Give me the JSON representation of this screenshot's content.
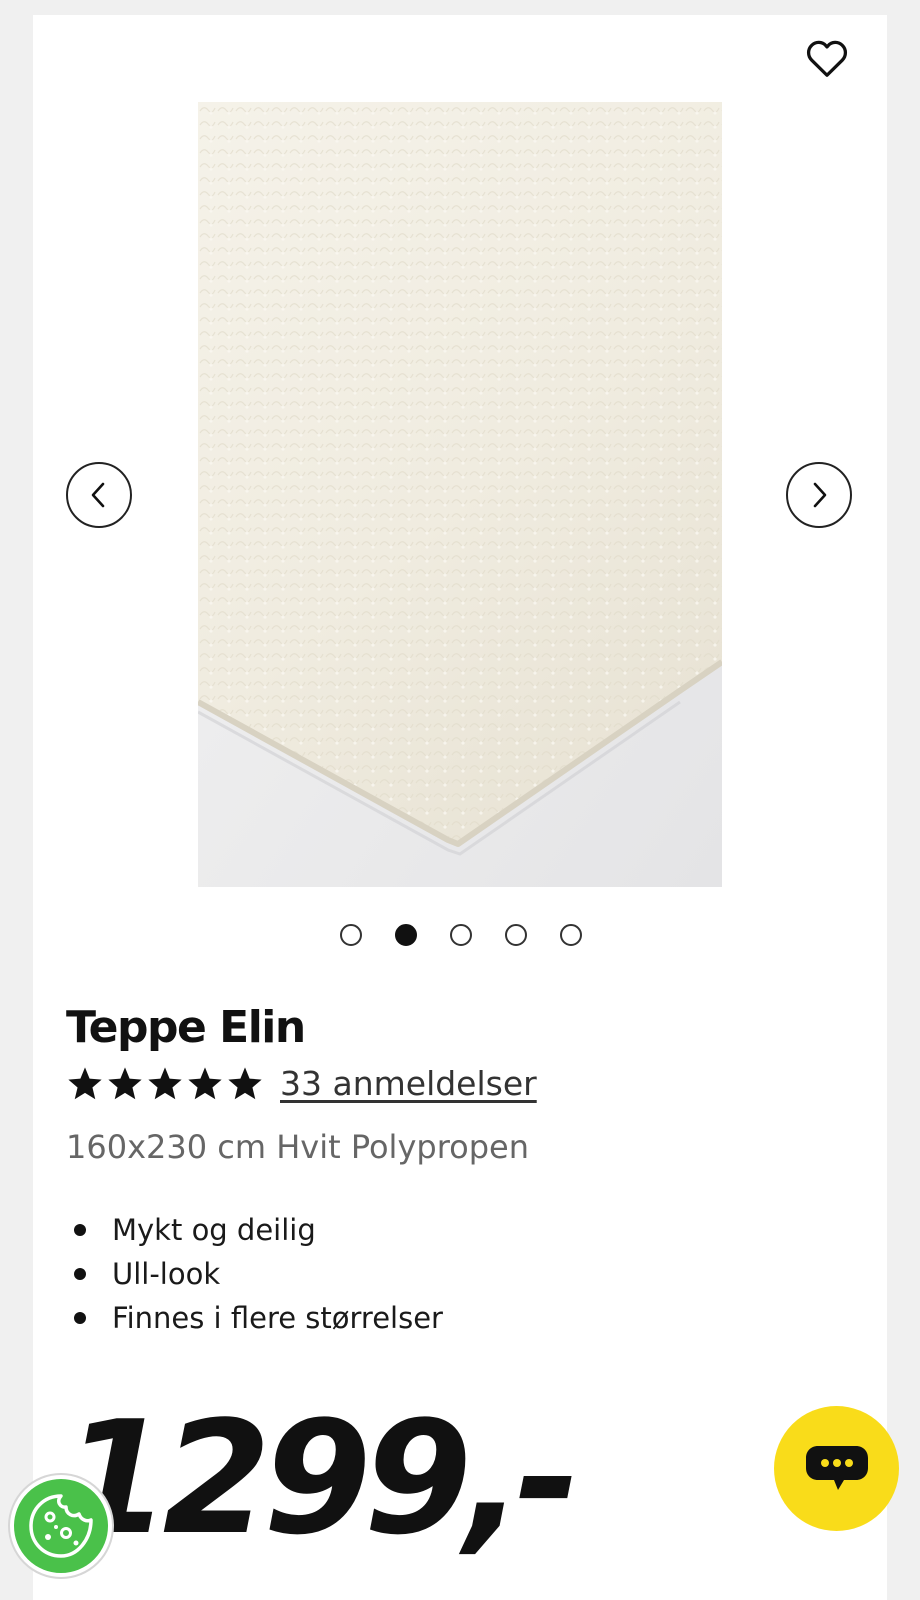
{
  "product": {
    "title": "Teppe Elin",
    "rating": 5,
    "reviews_label": "33 anmeldelser",
    "subtitle": "160x230 cm Hvit Polypropen",
    "features": [
      "Mykt og deilig",
      "Ull-look",
      "Finnes i flere størrelser"
    ],
    "price": "1299,-"
  },
  "gallery": {
    "image_count": 5,
    "active_index": 1
  },
  "icons": {
    "favorite": "heart-outline-icon",
    "prev": "chevron-left-icon",
    "next": "chevron-right-icon",
    "chat": "chat-bubble-icon",
    "cookie": "cookie-icon"
  },
  "colors": {
    "page_background": "#f0f0f0",
    "card": "#ffffff",
    "text": "#111111",
    "muted_text": "#666666",
    "chat_button": "#f9dc1a",
    "cookie_button": "#4ac14a",
    "rug": "#f2efe4"
  }
}
